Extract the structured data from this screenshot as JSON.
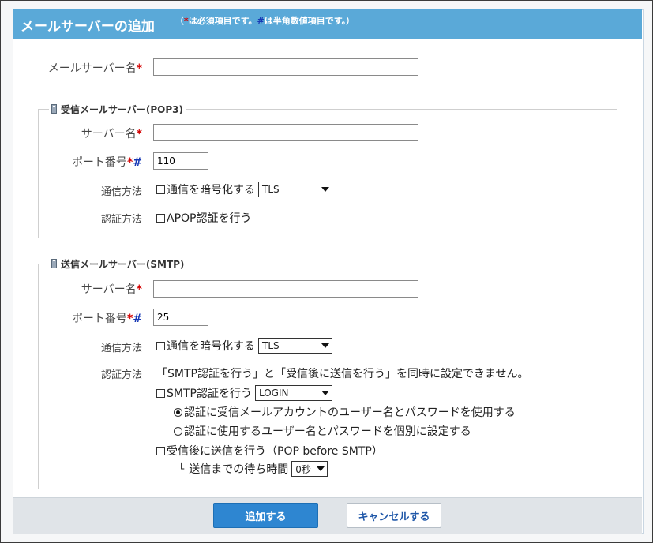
{
  "header": {
    "title": "メールサーバーの追加",
    "note_open": "（",
    "note_req_mark": "*",
    "note_req_text": "は必須項目です。",
    "note_num_mark": "#",
    "note_num_text": "は半角数値項目です。）"
  },
  "main": {
    "mail_server_name_label": "メールサーバー名",
    "mail_server_name_value": ""
  },
  "pop3": {
    "legend": "受信メールサーバー(POP3)",
    "server_name_label": "サーバー名",
    "server_name_value": "",
    "port_label": "ポート番号",
    "port_value": "110",
    "comm_label": "通信方法",
    "encrypt_text": "通信を暗号化する",
    "encrypt_checked": false,
    "encrypt_select": "TLS",
    "auth_label": "認証方法",
    "apop_text": "APOP認証を行う",
    "apop_checked": false
  },
  "smtp": {
    "legend": "送信メールサーバー(SMTP)",
    "server_name_label": "サーバー名",
    "server_name_value": "",
    "port_label": "ポート番号",
    "port_value": "25",
    "comm_label": "通信方法",
    "encrypt_text": "通信を暗号化する",
    "encrypt_checked": false,
    "encrypt_select": "TLS",
    "auth_label": "認証方法",
    "auth_note": "「SMTP認証を行う」と「受信後に送信を行う」を同時に設定できません。",
    "smtp_auth_text": "SMTP認証を行う",
    "smtp_auth_checked": false,
    "smtp_auth_select": "LOGIN",
    "radio1_text": "認証に受信メールアカウントのユーザー名とパスワードを使用する",
    "radio1_selected": true,
    "radio2_text": "認証に使用するユーザー名とパスワードを個別に設定する",
    "radio2_selected": false,
    "pop_before_text": "受信後に送信を行う（POP before SMTP）",
    "pop_before_checked": false,
    "wait_prefix": "└",
    "wait_text": "送信までの待ち時間",
    "wait_select": "0秒"
  },
  "required_mark": "*",
  "numeric_mark": "#",
  "footer": {
    "add_label": "追加する",
    "cancel_label": "キャンセルする"
  },
  "colors": {
    "header_bg": "#5aa9d8",
    "required": "#d40000",
    "numeric": "#1638b5",
    "primary_button": "#2e86d1"
  }
}
